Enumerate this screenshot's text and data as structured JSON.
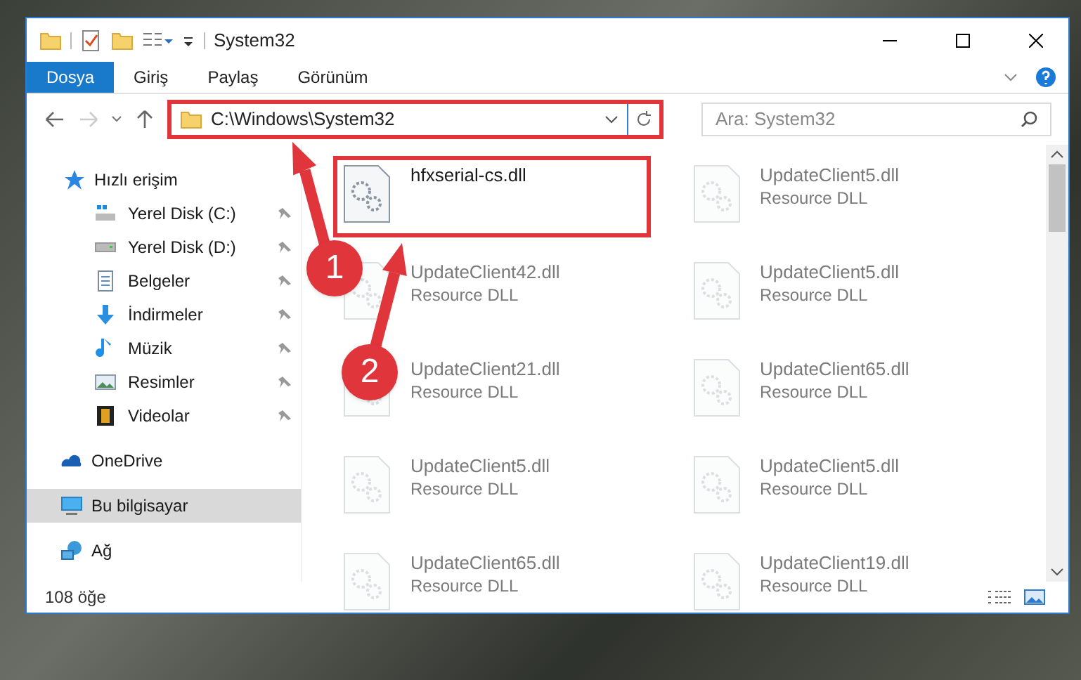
{
  "window": {
    "title": "System32"
  },
  "ribbon_tabs": [
    {
      "label": "Dosya",
      "selected": true
    },
    {
      "label": "Giriş",
      "selected": false
    },
    {
      "label": "Paylaş",
      "selected": false
    },
    {
      "label": "Görünüm",
      "selected": false
    }
  ],
  "address_bar": {
    "path": "C:\\Windows\\System32",
    "highlighted": true
  },
  "search": {
    "placeholder": "Ara: System32"
  },
  "sidebar": {
    "items": [
      {
        "label": "Hızlı erişim",
        "selected": false,
        "children": [
          {
            "label": "Yerel Disk (C:)",
            "pinned": true,
            "selected": false
          },
          {
            "label": "Yerel Disk (D:)",
            "pinned": true,
            "selected": false
          },
          {
            "label": "Belgeler",
            "pinned": true,
            "selected": false
          },
          {
            "label": "İndirmeler",
            "pinned": true,
            "selected": false
          },
          {
            "label": "Müzik",
            "pinned": true,
            "selected": false
          },
          {
            "label": "Resimler",
            "pinned": true,
            "selected": false
          },
          {
            "label": "Videolar",
            "pinned": true,
            "selected": false
          }
        ]
      },
      {
        "label": "OneDrive",
        "selected": false
      },
      {
        "label": "Bu bilgisayar",
        "selected": true
      },
      {
        "label": "Ağ",
        "selected": false
      }
    ]
  },
  "files": [
    {
      "name": "hfxserial-cs.dll",
      "highlighted": true,
      "blurred": false
    },
    {
      "name": "UpdateClient5.dll",
      "type": "Resource DLL",
      "highlighted": false,
      "blurred": true
    },
    {
      "name": "UpdateClient42.dll",
      "type": "Resource DLL",
      "highlighted": false,
      "blurred": true
    },
    {
      "name": "UpdateClient5.dll",
      "type": "Resource DLL",
      "highlighted": false,
      "blurred": true
    },
    {
      "name": "UpdateClient21.dll",
      "type": "Resource DLL",
      "highlighted": false,
      "blurred": true
    },
    {
      "name": "UpdateClient65.dll",
      "type": "Resource DLL",
      "highlighted": false,
      "blurred": true
    },
    {
      "name": "UpdateClient5.dll",
      "type": "Resource DLL",
      "highlighted": false,
      "blurred": true
    },
    {
      "name": "UpdateClient5.dll",
      "type": "Resource DLL",
      "highlighted": false,
      "blurred": true
    },
    {
      "name": "UpdateClient65.dll",
      "type": "Resource DLL",
      "highlighted": false,
      "blurred": true
    },
    {
      "name": "UpdateClient19.dll",
      "type": "Resource DLL",
      "highlighted": false,
      "blurred": true
    }
  ],
  "status_bar": {
    "item_count": "108 öğe"
  },
  "annotations": [
    {
      "number": "1"
    },
    {
      "number": "2"
    }
  ]
}
